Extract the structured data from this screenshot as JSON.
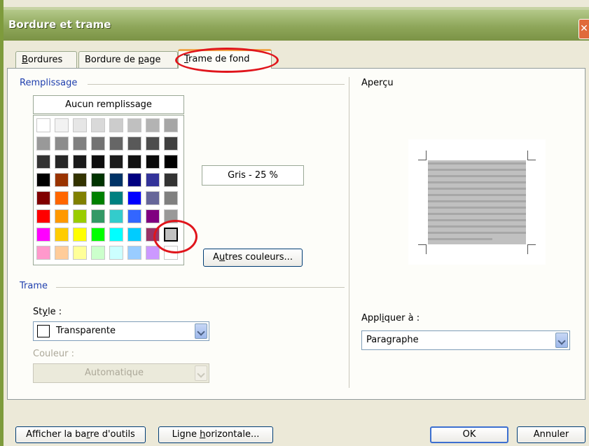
{
  "window": {
    "title": "Bordure et trame",
    "close": "✕"
  },
  "tabs": [
    {
      "label_pre": "",
      "label_u": "B",
      "label_post": "ordures"
    },
    {
      "label_pre": "Bordure de ",
      "label_u": "p",
      "label_post": "age"
    },
    {
      "label_pre": "",
      "label_u": "T",
      "label_post": "rame de fond"
    }
  ],
  "fill": {
    "group_label": "Remplissage",
    "no_fill": "Aucun remplissage",
    "selected_color_name": "Gris - 25 %",
    "more_colors": {
      "pre": "A",
      "u": "u",
      "post": "tres couleurs..."
    },
    "palette_rows": [
      [
        "#ffffff",
        "#f2f2f2",
        "#e6e6e6",
        "#d9d9d9",
        "#cccccc",
        "#c0c0c0",
        "#b3b3b3",
        "#a6a6a6"
      ],
      [
        "#999999",
        "#8c8c8c",
        "#808080",
        "#737373",
        "#666666",
        "#595959",
        "#4d4d4d",
        "#404040"
      ],
      [
        "#333333",
        "#262626",
        "#1a1a1a",
        "#0d0d0d",
        "#1c1c1c",
        "#111111",
        "#0a0a0a",
        "#000000"
      ],
      [
        "#000000",
        "#993300",
        "#333300",
        "#003300",
        "#003366",
        "#000080",
        "#333399",
        "#333333"
      ],
      [
        "#800000",
        "#ff6600",
        "#808000",
        "#008000",
        "#008080",
        "#0000ff",
        "#666699",
        "#808080"
      ],
      [
        "#ff0000",
        "#ff9900",
        "#99cc00",
        "#339966",
        "#33cccc",
        "#3366ff",
        "#800080",
        "#999999"
      ],
      [
        "#ff00ff",
        "#ffcc00",
        "#ffff00",
        "#00ff00",
        "#00ffff",
        "#00ccff",
        "#993366",
        "#c0c0c0"
      ],
      [
        "#ff99cc",
        "#ffcc99",
        "#ffff99",
        "#ccffcc",
        "#ccffff",
        "#99ccff",
        "#cc99ff",
        "#ffffff"
      ]
    ]
  },
  "pattern": {
    "group_label": "Trame",
    "style_label": {
      "pre": "St",
      "u": "y",
      "post": "le :"
    },
    "style_value": "Transparente",
    "color_label": "Couleur :",
    "color_value": "Automatique"
  },
  "preview": {
    "label": "Aperçu",
    "apply_label": {
      "pre": "Appl",
      "u": "i",
      "post": "quer à :"
    },
    "apply_value": "Paragraphe"
  },
  "footer": {
    "toolbar_btn": {
      "pre": "Afficher la ba",
      "u": "r",
      "post": "re d'outils"
    },
    "hline_btn": {
      "pre": "Ligne ",
      "u": "h",
      "post": "orizontale..."
    },
    "ok": "OK",
    "cancel": "Annuler"
  },
  "colors": {
    "highlight": "#e0151c",
    "title_bar": "#8ea65a",
    "group_label": "#1f3fae"
  }
}
